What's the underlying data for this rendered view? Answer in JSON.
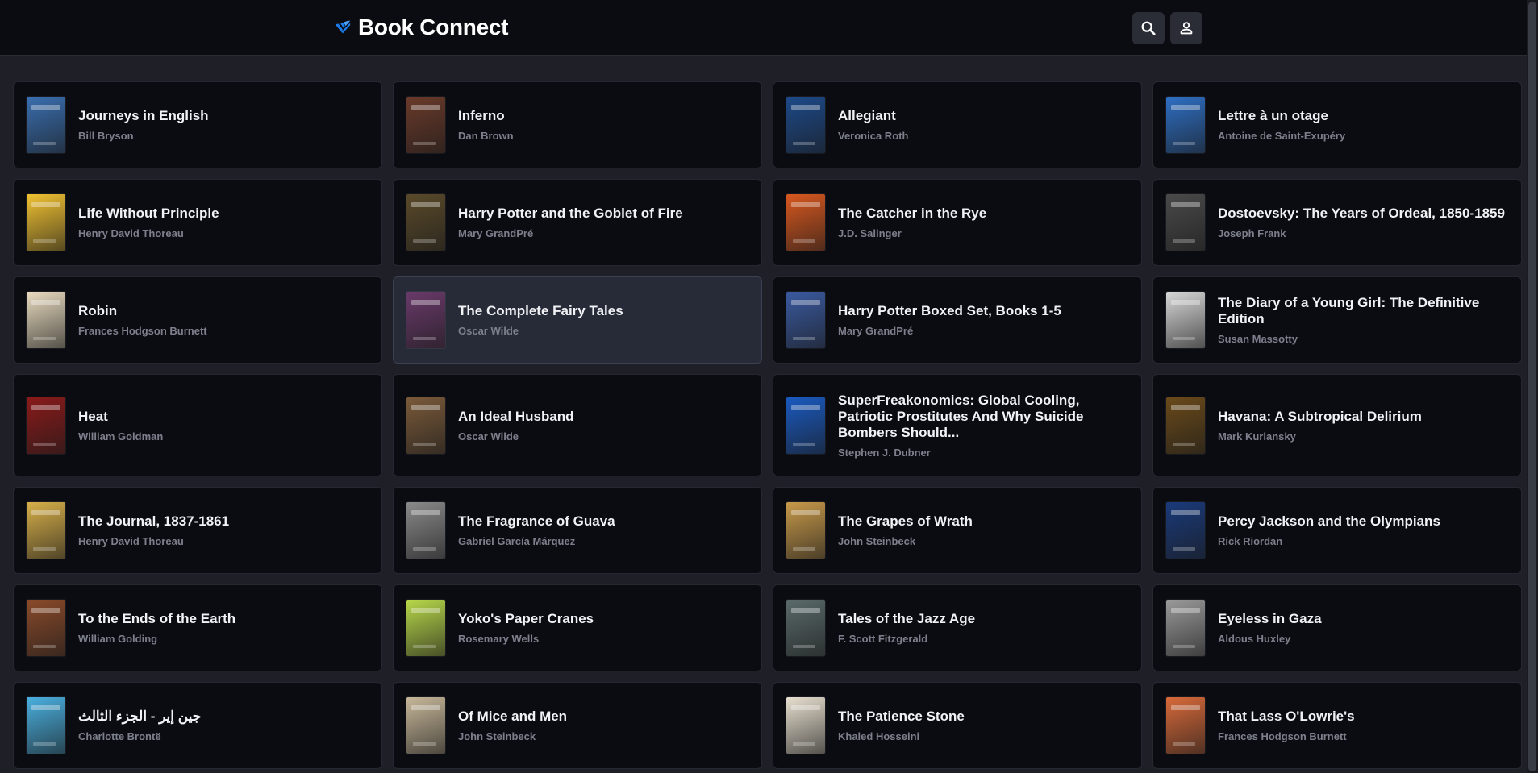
{
  "header": {
    "title": "Book Connect",
    "accent_color": "#1e7ce8",
    "search_icon": "search-icon",
    "profile_icon": "profile-icon"
  },
  "books": [
    {
      "title": "Journeys in English",
      "author": "Bill Bryson",
      "cover_color": "#3a6fb0"
    },
    {
      "title": "Inferno",
      "author": "Dan Brown",
      "cover_color": "#6a3a2a"
    },
    {
      "title": "Allegiant",
      "author": "Veronica Roth",
      "cover_color": "#1d4a8a"
    },
    {
      "title": "Lettre à un otage",
      "author": "Antoine de Saint-Exupéry",
      "cover_color": "#2e6fc4"
    },
    {
      "title": "Life Without Principle",
      "author": "Henry David Thoreau",
      "cover_color": "#f1c232"
    },
    {
      "title": "Harry Potter and the Goblet of Fire",
      "author": "Mary GrandPré",
      "cover_color": "#5a4a2a"
    },
    {
      "title": "The Catcher in the Rye",
      "author": "J.D. Salinger",
      "cover_color": "#d8581f"
    },
    {
      "title": "Dostoevsky: The Years of Ordeal, 1850-1859",
      "author": "Joseph Frank",
      "cover_color": "#4a4a4a"
    },
    {
      "title": "Robin",
      "author": "Frances Hodgson Burnett",
      "cover_color": "#e9dcc0"
    },
    {
      "title": "The Complete Fairy Tales",
      "author": "Oscar Wilde",
      "cover_color": "#6a3a6a"
    },
    {
      "title": "Harry Potter Boxed Set, Books 1-5",
      "author": "Mary GrandPré",
      "cover_color": "#3a5aa0"
    },
    {
      "title": "The Diary of a Young Girl: The Definitive Edition",
      "author": "Susan Massotty",
      "cover_color": "#d8d8d8"
    },
    {
      "title": "Heat",
      "author": "William Goldman",
      "cover_color": "#8a1a1a"
    },
    {
      "title": "An Ideal Husband",
      "author": "Oscar Wilde",
      "cover_color": "#7a5a3a"
    },
    {
      "title": "SuperFreakonomics: Global Cooling, Patriotic Prostitutes And Why Suicide Bombers Should...",
      "author": "Stephen J. Dubner",
      "cover_color": "#1a5ac0"
    },
    {
      "title": "Havana: A Subtropical Delirium",
      "author": "Mark Kurlansky",
      "cover_color": "#6a4a1a"
    },
    {
      "title": "The Journal, 1837-1861",
      "author": "Henry David Thoreau",
      "cover_color": "#d8b04a"
    },
    {
      "title": "The Fragrance of Guava",
      "author": "Gabriel García Márquez",
      "cover_color": "#8a8a8a"
    },
    {
      "title": "The Grapes of Wrath",
      "author": "John Steinbeck",
      "cover_color": "#c89a4a"
    },
    {
      "title": "Percy Jackson and the Olympians",
      "author": "Rick Riordan",
      "cover_color": "#1a3a7a"
    },
    {
      "title": "To the Ends of the Earth",
      "author": "William Golding",
      "cover_color": "#8a4a2a"
    },
    {
      "title": "Yoko's Paper Cranes",
      "author": "Rosemary Wells",
      "cover_color": "#b8d84a"
    },
    {
      "title": "Tales of the Jazz Age",
      "author": "F. Scott Fitzgerald",
      "cover_color": "#5a6a6a"
    },
    {
      "title": "Eyeless in Gaza",
      "author": "Aldous Huxley",
      "cover_color": "#9a9a9a"
    },
    {
      "title": "جين إير - الجزء الثالث",
      "author": "Charlotte Brontë",
      "cover_color": "#4ab0e0"
    },
    {
      "title": "Of Mice and Men",
      "author": "John Steinbeck",
      "cover_color": "#c8b89a"
    },
    {
      "title": "The Patience Stone",
      "author": "Khaled Hosseini",
      "cover_color": "#e8e0d0"
    },
    {
      "title": "That Lass O'Lowrie's",
      "author": "Frances Hodgson Burnett",
      "cover_color": "#d86a3a"
    }
  ]
}
